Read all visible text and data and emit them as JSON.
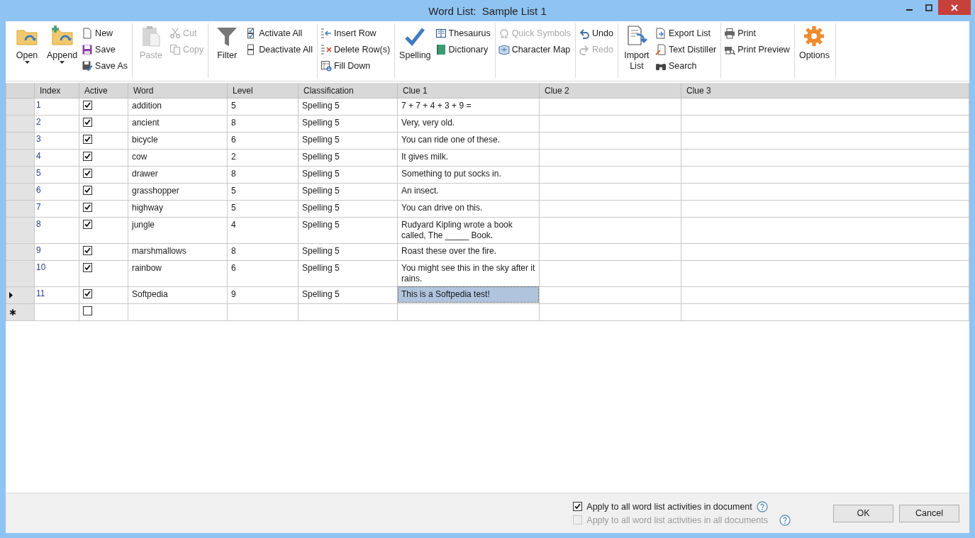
{
  "window": {
    "title": "Word List:  Sample List 1"
  },
  "ribbon": {
    "groups": [
      {
        "columns": [
          {
            "kind": "large",
            "items": [
              {
                "label": "Open",
                "dropdown": true,
                "disabled": false
              }
            ]
          },
          {
            "kind": "large",
            "items": [
              {
                "label": "Append",
                "dropdown": true,
                "disabled": false
              }
            ]
          },
          {
            "kind": "small",
            "items": [
              {
                "label": "New",
                "disabled": false
              },
              {
                "label": "Save",
                "disabled": false
              },
              {
                "label": "Save As",
                "disabled": false
              }
            ]
          }
        ]
      },
      {
        "columns": [
          {
            "kind": "large",
            "items": [
              {
                "label": "Paste",
                "dropdown": false,
                "disabled": true
              }
            ]
          },
          {
            "kind": "small",
            "items": [
              {
                "label": "Cut",
                "disabled": true
              },
              {
                "label": "Copy",
                "disabled": true
              }
            ]
          }
        ]
      },
      {
        "columns": [
          {
            "kind": "large",
            "items": [
              {
                "label": "Filter",
                "dropdown": false,
                "disabled": false
              }
            ]
          },
          {
            "kind": "small",
            "items": [
              {
                "label": "Activate All",
                "disabled": false
              },
              {
                "label": "Deactivate All",
                "disabled": false
              }
            ]
          }
        ]
      },
      {
        "columns": [
          {
            "kind": "small",
            "items": [
              {
                "label": "Insert Row",
                "disabled": false
              },
              {
                "label": "Delete Row(s)",
                "disabled": false
              },
              {
                "label": "Fill Down",
                "disabled": false
              }
            ]
          }
        ]
      },
      {
        "columns": [
          {
            "kind": "large",
            "items": [
              {
                "label": "Spelling",
                "dropdown": false,
                "disabled": false
              }
            ]
          },
          {
            "kind": "small",
            "items": [
              {
                "label": "Thesaurus",
                "disabled": false
              },
              {
                "label": "Dictionary",
                "disabled": false
              }
            ]
          }
        ]
      },
      {
        "columns": [
          {
            "kind": "small",
            "items": [
              {
                "label": "Quick Symbols",
                "disabled": true
              },
              {
                "label": "Character Map",
                "disabled": false
              }
            ]
          }
        ]
      },
      {
        "columns": [
          {
            "kind": "small",
            "items": [
              {
                "label": "Undo",
                "disabled": false
              },
              {
                "label": "Redo",
                "disabled": true
              }
            ]
          }
        ]
      },
      {
        "columns": [
          {
            "kind": "large",
            "items": [
              {
                "label": "Import List",
                "dropdown": false,
                "disabled": false
              }
            ]
          },
          {
            "kind": "small",
            "items": [
              {
                "label": "Export List",
                "disabled": false
              },
              {
                "label": "Text Distiller",
                "disabled": false
              },
              {
                "label": "Search",
                "disabled": false
              }
            ]
          }
        ]
      },
      {
        "columns": [
          {
            "kind": "small",
            "items": [
              {
                "label": "Print",
                "disabled": false
              },
              {
                "label": "Print Preview",
                "disabled": false
              }
            ]
          }
        ]
      },
      {
        "columns": [
          {
            "kind": "large",
            "items": [
              {
                "label": "Options",
                "dropdown": false,
                "disabled": false
              }
            ]
          }
        ]
      }
    ]
  },
  "table": {
    "columns": [
      "Index",
      "Active",
      "Word",
      "Level",
      "Classification",
      "Clue 1",
      "Clue 2",
      "Clue 3"
    ],
    "rows": [
      {
        "index": "1",
        "active": true,
        "word": "addition",
        "level": "5",
        "classification": "Spelling 5",
        "clue_1": "7 + 7 + 4 + 3 + 9 =",
        "current": false,
        "clue_1_selected": false
      },
      {
        "index": "2",
        "active": true,
        "word": "ancient",
        "level": "8",
        "classification": "Spelling 5",
        "clue_1": "Very, very old.",
        "current": false,
        "clue_1_selected": false
      },
      {
        "index": "3",
        "active": true,
        "word": "bicycle",
        "level": "6",
        "classification": "Spelling 5",
        "clue_1": "You can ride one of these.",
        "current": false,
        "clue_1_selected": false
      },
      {
        "index": "4",
        "active": true,
        "word": "cow",
        "level": "2",
        "classification": "Spelling 5",
        "clue_1": "It gives milk.",
        "current": false,
        "clue_1_selected": false
      },
      {
        "index": "5",
        "active": true,
        "word": "drawer",
        "level": "8",
        "classification": "Spelling 5",
        "clue_1": "Something to put socks in.",
        "current": false,
        "clue_1_selected": false
      },
      {
        "index": "6",
        "active": true,
        "word": "grasshopper",
        "level": "5",
        "classification": "Spelling 5",
        "clue_1": "An insect.",
        "current": false,
        "clue_1_selected": false
      },
      {
        "index": "7",
        "active": true,
        "word": "highway",
        "level": "5",
        "classification": "Spelling 5",
        "clue_1": "You can drive on this.",
        "current": false,
        "clue_1_selected": false
      },
      {
        "index": "8",
        "active": true,
        "word": "jungle",
        "level": "4",
        "classification": "Spelling 5",
        "clue_1": "Rudyard Kipling wrote a book called, The _____ Book.",
        "current": false,
        "clue_1_selected": false
      },
      {
        "index": "9",
        "active": true,
        "word": "marshmallows",
        "level": "8",
        "classification": "Spelling 5",
        "clue_1": "Roast these over the fire.",
        "current": false,
        "clue_1_selected": false
      },
      {
        "index": "10",
        "active": true,
        "word": "rainbow",
        "level": "6",
        "classification": "Spelling 5",
        "clue_1": "You might see this in the sky after it rains.",
        "current": false,
        "clue_1_selected": false
      },
      {
        "index": "11",
        "active": true,
        "word": "Softpedia",
        "level": "9",
        "classification": "Spelling 5",
        "clue_1": "This is a Softpedia test!",
        "current": true,
        "clue_1_selected": true
      }
    ],
    "new_row": {
      "marker": "✱",
      "active": false
    }
  },
  "options": [
    {
      "label": "Apply to all word list activities in document",
      "checked": true,
      "disabled": false
    },
    {
      "label": "Apply to all word list activities in all documents",
      "checked": false,
      "disabled": true
    }
  ],
  "buttons": [
    "OK",
    "Cancel"
  ]
}
